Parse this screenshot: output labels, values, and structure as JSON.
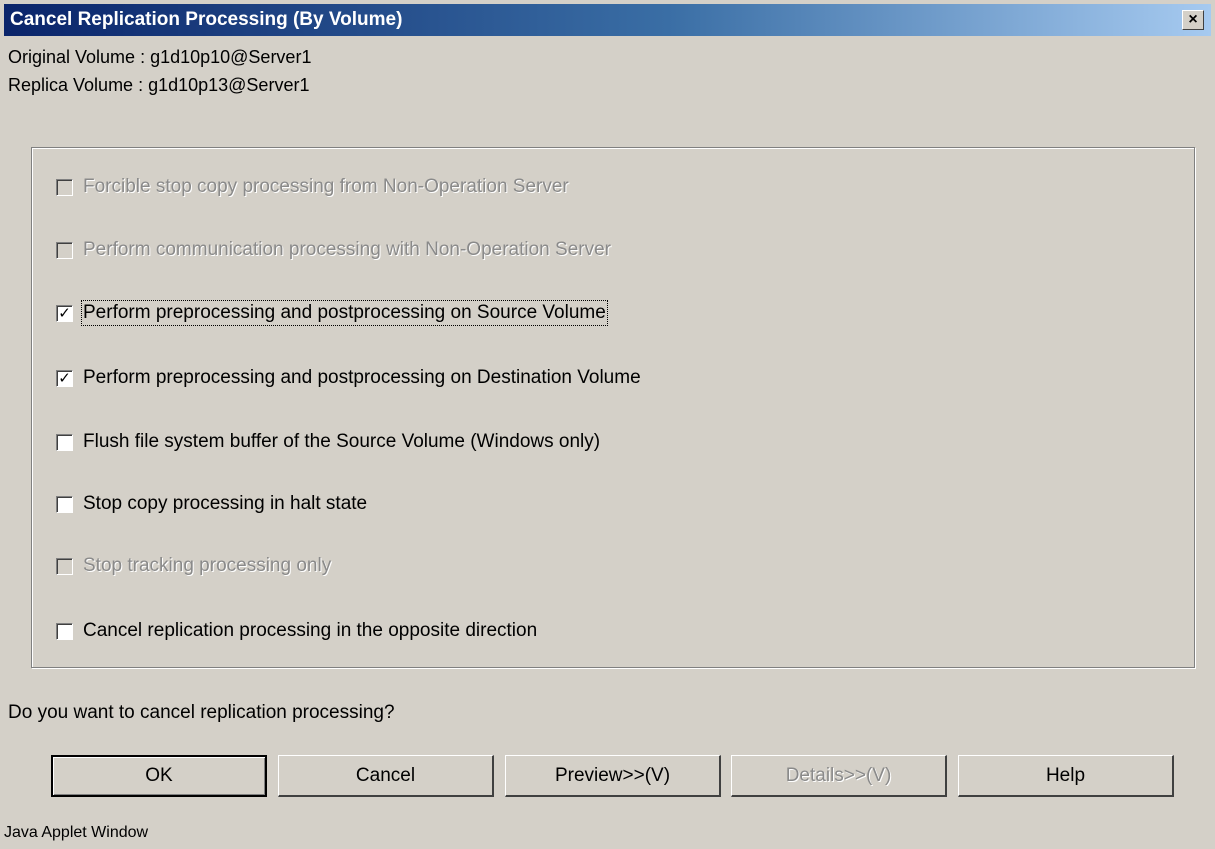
{
  "window": {
    "title": "Cancel Replication Processing (By Volume)",
    "close_glyph": "×"
  },
  "info": {
    "original": "Original Volume : g1d10p10@Server1",
    "replica": "Replica Volume : g1d10p13@Server1"
  },
  "options": [
    {
      "label": "Forcible stop copy processing from Non-Operation Server",
      "checked": false,
      "enabled": false
    },
    {
      "label": "Perform communication processing with Non-Operation Server",
      "checked": false,
      "enabled": false
    },
    {
      "label": "Perform preprocessing and postprocessing on Source Volume",
      "checked": true,
      "enabled": true
    },
    {
      "label": "Perform preprocessing and postprocessing on Destination Volume",
      "checked": true,
      "enabled": true
    },
    {
      "label": "Flush file system buffer of the Source Volume (Windows only)",
      "checked": false,
      "enabled": true
    },
    {
      "label": "Stop copy processing in halt state",
      "checked": false,
      "enabled": true
    },
    {
      "label": "Stop tracking processing only",
      "checked": false,
      "enabled": false
    },
    {
      "label": "Cancel replication processing in the opposite direction",
      "checked": false,
      "enabled": true
    }
  ],
  "question": "Do you want to cancel replication processing?",
  "buttons": {
    "ok": "OK",
    "cancel": "Cancel",
    "preview": "Preview>>(V)",
    "details": "Details>>(V)",
    "help": "Help"
  },
  "status": "Java Applet Window",
  "check_glyph": "✓"
}
